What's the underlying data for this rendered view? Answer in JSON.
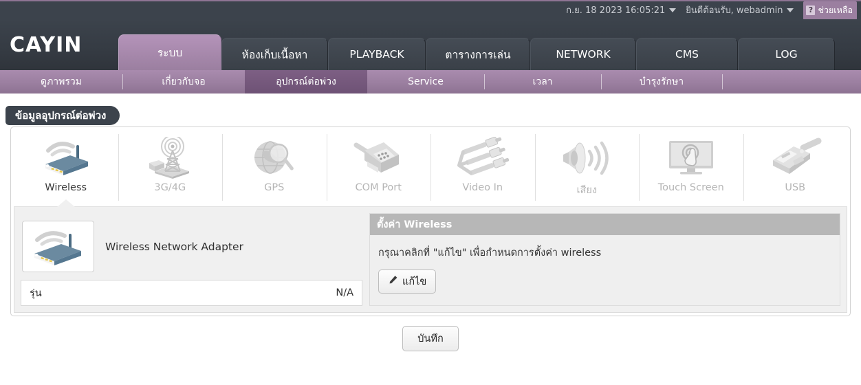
{
  "topbar": {
    "datetime": "ก.ย. 18 2023 16:05:21",
    "welcome": "ยินดีต้อนรับ, webadmin",
    "help_label": "ช่วยเหลือ",
    "help_icon_char": "?"
  },
  "brand": {
    "logo_text": "CAYIN"
  },
  "mainnav": {
    "tabs": [
      {
        "label": "ระบบ",
        "active": true
      },
      {
        "label": "ห้องเก็บเนื้อหา",
        "active": false
      },
      {
        "label": "PLAYBACK",
        "active": false
      },
      {
        "label": "ตารางการเล่น",
        "active": false
      },
      {
        "label": "NETWORK",
        "active": false
      },
      {
        "label": "CMS",
        "active": false
      },
      {
        "label": "LOG",
        "active": false
      }
    ]
  },
  "subnav": {
    "items": [
      {
        "label": "ดูภาพรวม",
        "active": false
      },
      {
        "label": "เกี่ยวกับจอ",
        "active": false
      },
      {
        "label": "อุปกรณ์ต่อพ่วง",
        "active": true
      },
      {
        "label": "Service",
        "active": false
      },
      {
        "label": "เวลา",
        "active": false
      },
      {
        "label": "บำรุงรักษา",
        "active": false
      },
      {
        "label": "",
        "active": false
      }
    ]
  },
  "page": {
    "title": "ข้อมูลอุปกรณ์ต่อพ่วง"
  },
  "devices": [
    {
      "label": "Wireless",
      "icon": "wireless-router-icon",
      "active": true
    },
    {
      "label": "3G/4G",
      "icon": "cell-tower-icon",
      "active": false
    },
    {
      "label": "GPS",
      "icon": "globe-magnifier-icon",
      "active": false
    },
    {
      "label": "COM Port",
      "icon": "serial-port-icon",
      "active": false
    },
    {
      "label": "Video In",
      "icon": "rca-cables-icon",
      "active": false
    },
    {
      "label": "เสียง",
      "icon": "speaker-icon",
      "active": false
    },
    {
      "label": "Touch Screen",
      "icon": "touch-screen-icon",
      "active": false
    },
    {
      "label": "USB",
      "icon": "usb-connector-icon",
      "active": false
    }
  ],
  "detail": {
    "adapter_name": "Wireless Network Adapter",
    "adapter_icon": "wireless-router-icon",
    "model_label": "รุ่น",
    "model_value": "N/A"
  },
  "settings": {
    "header": "ตั้งค่า Wireless",
    "hint": "กรุณาคลิกที่ \"แก้ไข\" เพื่อกำหนดการตั้งค่า wireless",
    "edit_label": "แก้ไข",
    "edit_icon": "pencil-icon"
  },
  "footer": {
    "save_label": "บันทึก"
  },
  "colors": {
    "dark_nav": "#3c434c",
    "accent_purple": "#9b7fa0",
    "active_subnav": "#7d5f84",
    "panel_header_gray": "#b7b7b7",
    "page_bg": "#ffffff"
  }
}
